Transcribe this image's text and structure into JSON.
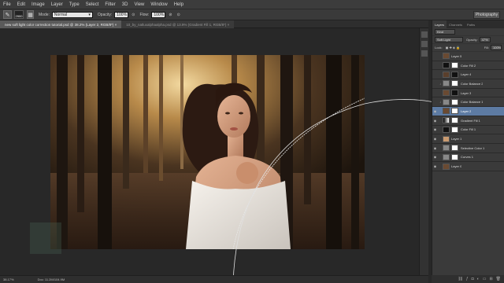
{
  "menu": [
    "File",
    "Edit",
    "Image",
    "Layer",
    "Type",
    "Select",
    "Filter",
    "3D",
    "View",
    "Window",
    "Help"
  ],
  "options": {
    "brush_size": "2900",
    "mode_label": "Mode:",
    "mode_value": "Normal",
    "opacity_label": "Opacity:",
    "opacity_value": "100%",
    "flow_label": "Flow:",
    "flow_value": "100%",
    "workspace": "Photography"
  },
  "tabs": [
    {
      "label": "new soft light color correction tutorial.psd @ 38.2% (Layer 2, RGB/8*) ×"
    },
    {
      "label": "10_by_natluxalphaalpha.psd @ 13.9% (Gradient Fill 1, RGB/8*) ×"
    }
  ],
  "status": {
    "zoom": "38.17%",
    "doc": "Doc: 11.2M/104.9M"
  },
  "panel": {
    "tabs": [
      "Layers",
      "Channels",
      "Paths"
    ],
    "kind": "Kind",
    "blend": "Soft Light",
    "opacity_label": "Opacity:",
    "opacity_value": "47%",
    "lock_label": "Lock:",
    "fill_label": "Fill:",
    "fill_value": "100%"
  },
  "layers": [
    {
      "name": "Layer 5"
    },
    {
      "name": "Color Fill 2"
    },
    {
      "name": "Layer 4"
    },
    {
      "name": "Color Balance 2"
    },
    {
      "name": "Layer 3"
    },
    {
      "name": "Color Balance 1"
    },
    {
      "name": "Layer 2"
    },
    {
      "name": "Gradient Fill 1"
    },
    {
      "name": "Color Fill 1"
    },
    {
      "name": "Layer 1"
    },
    {
      "name": "Selective Color 1"
    },
    {
      "name": "Curves 1"
    },
    {
      "name": "Layer 0"
    }
  ],
  "colors": {
    "selection": "#5d7ba3",
    "panel": "#3a3a3a",
    "workspace": "#282828"
  }
}
